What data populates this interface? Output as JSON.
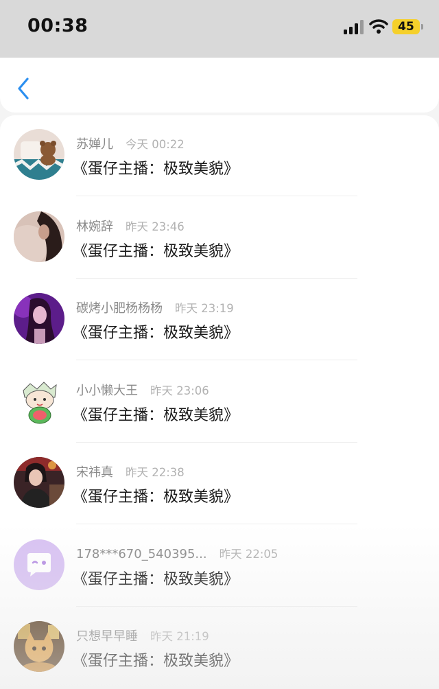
{
  "status_bar": {
    "time": "00:38",
    "battery": "45",
    "icons": [
      "signal-icon",
      "wifi-icon",
      "battery-icon"
    ]
  },
  "nav": {
    "back_icon": "chevron-left-icon",
    "accent": "#2b8ff0"
  },
  "items": [
    {
      "name": "苏婵儿",
      "time": "今天 00:22",
      "message": "《蛋仔主播：极致美貌》",
      "avatar": "teddy-bear-avatar"
    },
    {
      "name": "林婉辞",
      "time": "昨天 23:46",
      "message": "《蛋仔主播：极致美貌》",
      "avatar": "portrait-avatar"
    },
    {
      "name": "碳烤小肥杨杨杨",
      "time": "昨天 23:19",
      "message": "《蛋仔主播：极致美貌》",
      "avatar": "purple-portrait-avatar"
    },
    {
      "name": "小小懒大王",
      "time": "昨天 23:06",
      "message": "《蛋仔主播：极致美貌》",
      "avatar": "cartoon-avatar"
    },
    {
      "name": "宋祎真",
      "time": "昨天 22:38",
      "message": "《蛋仔主播：极致美貌》",
      "avatar": "girl-photo-avatar"
    },
    {
      "name": "178***670_540395...",
      "time": "昨天 22:05",
      "message": "《蛋仔主播：极致美貌》",
      "avatar": "default-chat-avatar"
    },
    {
      "name": "只想早早睡",
      "time": "昨天 21:19",
      "message": "《蛋仔主播：极致美貌》",
      "avatar": "cat-avatar"
    }
  ]
}
